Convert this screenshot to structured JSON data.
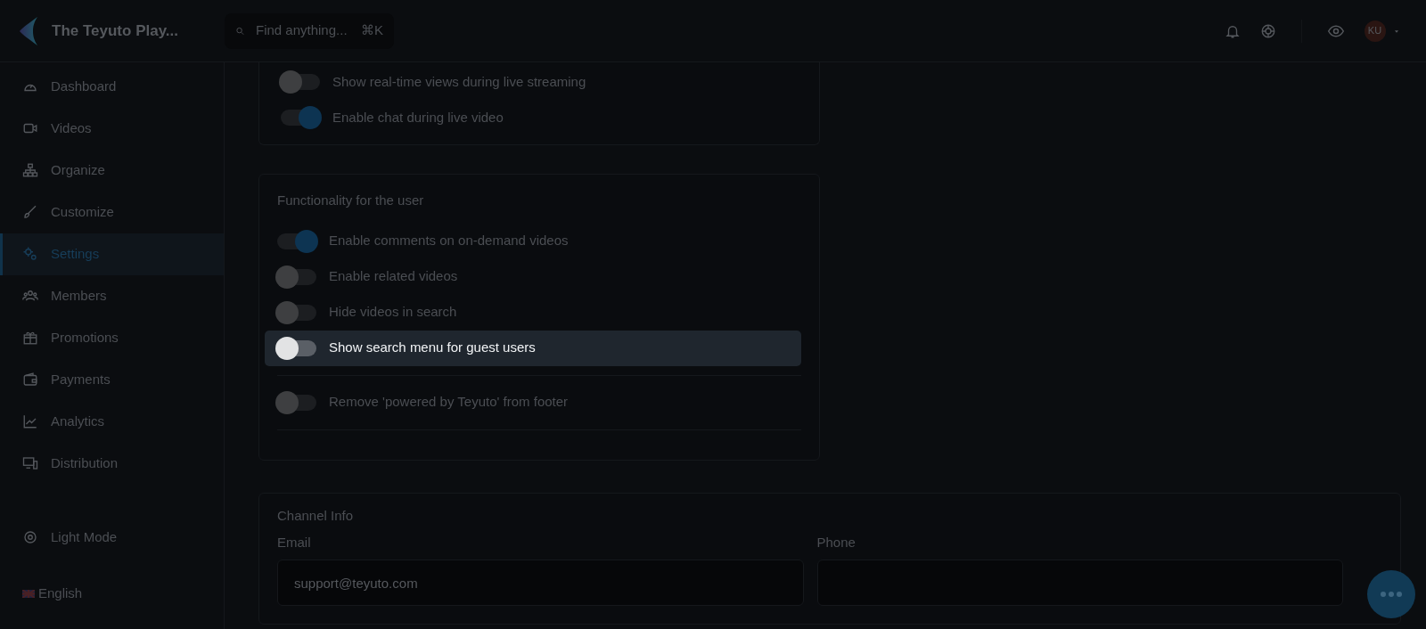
{
  "brand": {
    "name": "The Teyuto Play..."
  },
  "search": {
    "placeholder": "Find anything...",
    "shortcut": "⌘K"
  },
  "user": {
    "initials": "KU"
  },
  "sidebar": {
    "items": [
      {
        "label": "Dashboard",
        "selected": false
      },
      {
        "label": "Videos",
        "selected": false
      },
      {
        "label": "Organize",
        "selected": false
      },
      {
        "label": "Customize",
        "selected": false
      },
      {
        "label": "Settings",
        "selected": true
      },
      {
        "label": "Members",
        "selected": false
      },
      {
        "label": "Promotions",
        "selected": false
      },
      {
        "label": "Payments",
        "selected": false
      },
      {
        "label": "Analytics",
        "selected": false
      },
      {
        "label": "Distribution",
        "selected": false
      }
    ],
    "theme_toggle": "Light Mode",
    "language": "English"
  },
  "live_settings": {
    "toggles": [
      {
        "label": "Show real-time views during live streaming",
        "on": false,
        "highlighted": false
      },
      {
        "label": "Enable chat during live video",
        "on": true,
        "highlighted": false
      }
    ]
  },
  "user_functionality": {
    "title": "Functionality for the user",
    "toggles": [
      {
        "label": "Enable comments on on-demand videos",
        "on": true,
        "highlighted": false
      },
      {
        "label": "Enable related videos",
        "on": false,
        "highlighted": false
      },
      {
        "label": "Hide videos in search",
        "on": false,
        "highlighted": false
      },
      {
        "label": "Show search menu for guest users",
        "on": false,
        "highlighted": true
      }
    ],
    "footer_toggles": [
      {
        "label": "Remove 'powered by Teyuto' from footer",
        "on": false,
        "highlighted": false
      }
    ]
  },
  "channel_info": {
    "title": "Channel Info",
    "fields": [
      {
        "label": "Email",
        "value": "support@teyuto.com"
      },
      {
        "label": "Phone"
      }
    ]
  }
}
